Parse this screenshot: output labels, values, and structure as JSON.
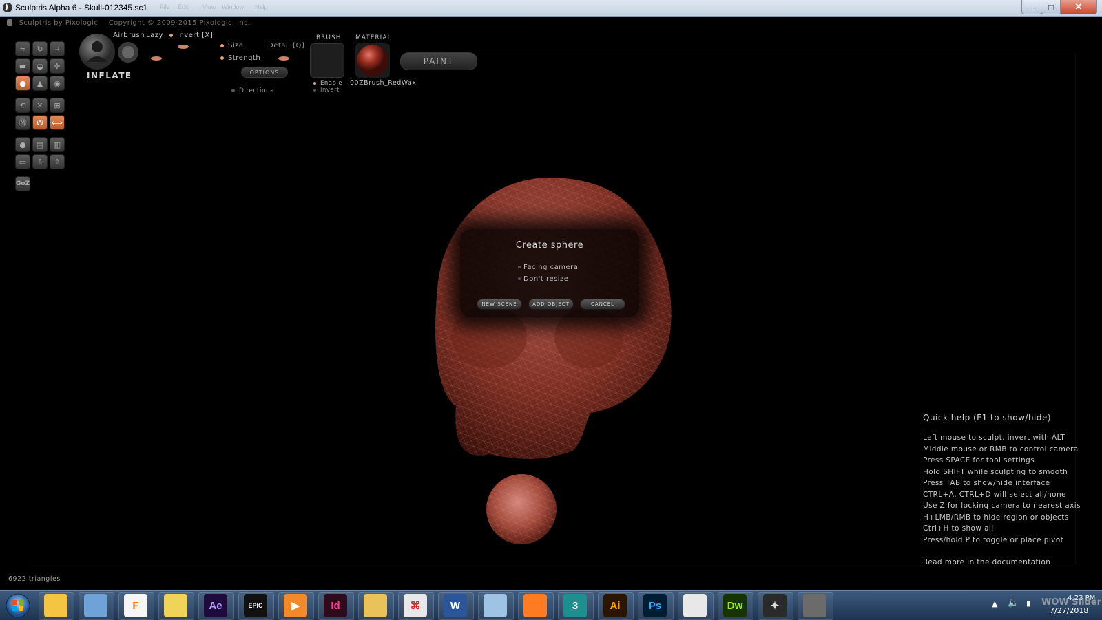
{
  "window": {
    "title": "Sculptris Alpha 6 - Skull-012345.sc1",
    "menu": [
      "File",
      "Edit",
      "View",
      "Window",
      "Help"
    ],
    "close_glyph": "✕",
    "minimize_glyph": "–",
    "maximize_glyph": "□"
  },
  "header": {
    "brand": "Sculptris by Pixologic",
    "copyright": "Copyright © 2009-2015 Pixologic, Inc."
  },
  "tools": {
    "goz": "GoZ"
  },
  "brush_panel": {
    "tool_name": "INFLATE",
    "airbrush": "Airbrush",
    "lazy": "Lazy",
    "invert": "Invert [X]",
    "size": "Size",
    "detail": "Detail [Q]",
    "strength": "Strength",
    "options": "OPTIONS",
    "directional": "Directional",
    "brush_header": "BRUSH",
    "enable": "Enable",
    "invert_texture": "Invert",
    "material_header": "MATERIAL",
    "material_name": "00ZBrush_RedWax",
    "paint": "PAINT"
  },
  "dialog": {
    "title": "Create sphere",
    "options": [
      "Facing camera",
      "Don't resize"
    ],
    "buttons": {
      "new_scene": "NEW SCENE",
      "add_object": "ADD OBJECT",
      "cancel": "CANCEL"
    }
  },
  "quick_help": {
    "title": "Quick help (F1 to show/hide)",
    "lines": [
      "Left mouse to sculpt, invert with ALT",
      "Middle mouse or RMB to control camera",
      "Press SPACE for tool settings",
      "Hold SHIFT while sculpting to smooth",
      "Press TAB to show/hide interface",
      "CTRL+A, CTRL+D will select all/none",
      "Use Z for locking camera to nearest axis",
      "H+LMB/RMB to hide region or objects",
      "Ctrl+H to show all",
      "Press/hold P to toggle or place pivot"
    ],
    "doc_link": "Read more in the documentation"
  },
  "status": {
    "triangles": "6922 triangles"
  },
  "taskbar": {
    "apps": [
      {
        "name": "windows-explorer-icon",
        "label": "",
        "color": "#f4c542",
        "fg": "#fff"
      },
      {
        "name": "app-box-icon",
        "label": "",
        "color": "#6fa3d8",
        "fg": "#fff"
      },
      {
        "name": "fl-studio-icon",
        "label": "F",
        "color": "#f6f6f6",
        "fg": "#e87a18"
      },
      {
        "name": "photos-icon",
        "label": "",
        "color": "#f0d45a",
        "fg": "#fff"
      },
      {
        "name": "after-effects-icon",
        "label": "Ae",
        "color": "#1f0a3d",
        "fg": "#b49cff"
      },
      {
        "name": "epic-games-icon",
        "label": "EPIC",
        "color": "#111",
        "fg": "#fff"
      },
      {
        "name": "media-player-icon",
        "label": "▶",
        "color": "#f28a2b",
        "fg": "#fff"
      },
      {
        "name": "indesign-icon",
        "label": "Id",
        "color": "#2e0b1c",
        "fg": "#ff3d8b"
      },
      {
        "name": "file-explorer-icon",
        "label": "",
        "color": "#e9c25a",
        "fg": "#fff"
      },
      {
        "name": "acrobat-icon",
        "label": "⌘",
        "color": "#e8e8e8",
        "fg": "#d3261d"
      },
      {
        "name": "word-icon",
        "label": "W",
        "color": "#2b579a",
        "fg": "#fff"
      },
      {
        "name": "image-viewer-icon",
        "label": "",
        "color": "#9fc3e4",
        "fg": "#fff"
      },
      {
        "name": "firefox-icon",
        "label": "",
        "color": "#ff7b22",
        "fg": "#fff"
      },
      {
        "name": "3ds-max-icon",
        "label": "3",
        "color": "#1e8f8f",
        "fg": "#fff"
      },
      {
        "name": "illustrator-icon",
        "label": "Ai",
        "color": "#2b1500",
        "fg": "#ff9a00"
      },
      {
        "name": "photoshop-icon",
        "label": "Ps",
        "color": "#001d34",
        "fg": "#31a8ff"
      },
      {
        "name": "chrome-icon",
        "label": "",
        "color": "#e8e8e8",
        "fg": "#fff"
      },
      {
        "name": "dreamweaver-icon",
        "label": "Dw",
        "color": "#173400",
        "fg": "#9cf200"
      },
      {
        "name": "blender-icon",
        "label": "✦",
        "color": "#2a2a2a",
        "fg": "#ddd"
      },
      {
        "name": "sculptris-icon",
        "label": "",
        "color": "#6b6b6b",
        "fg": "#fff"
      }
    ],
    "time": "4:23 PM",
    "date": "7/27/2018",
    "watermark": "WOW Slider"
  },
  "colors": {
    "accent": "#e58b5b",
    "model": "#8b3a2c",
    "taskbar": "#1d3350"
  }
}
